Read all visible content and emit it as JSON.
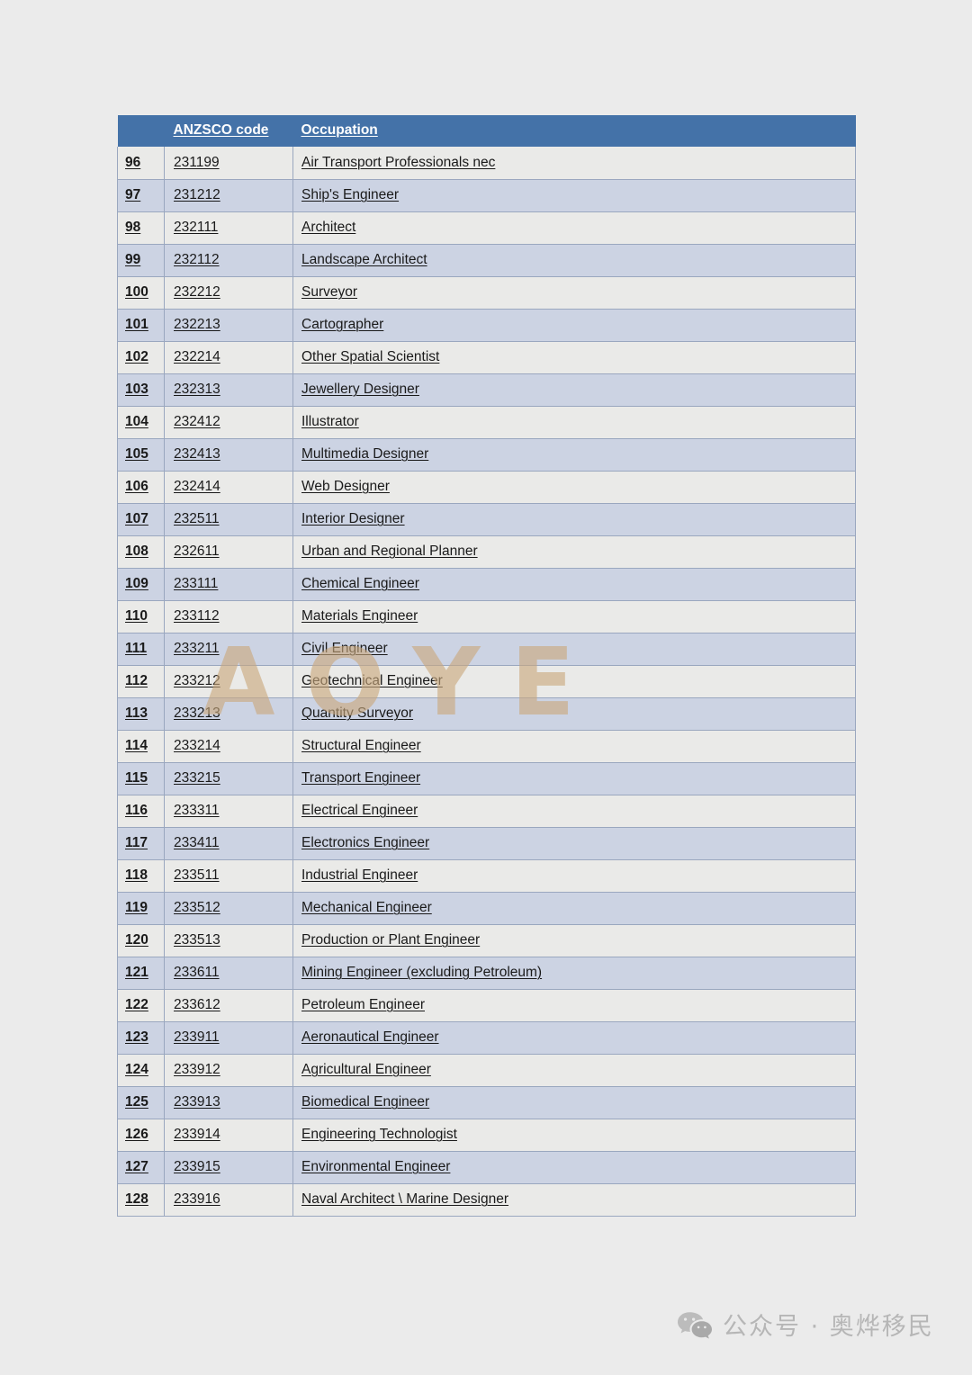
{
  "page": {
    "background_color": "#ebebeb"
  },
  "table": {
    "header_bg": "#4472a8",
    "row_color_a": "#eaeae8",
    "row_color_b": "#ccd3e3",
    "border_color": "#9aa7bf",
    "columns": [
      "",
      "ANZSCO code",
      "Occupation"
    ],
    "rows": [
      {
        "index": "96",
        "code": "231199",
        "occupation": "Air Transport Professionals nec"
      },
      {
        "index": "97",
        "code": "231212",
        "occupation": "Ship's Engineer"
      },
      {
        "index": "98",
        "code": "232111",
        "occupation": "Architect"
      },
      {
        "index": "99",
        "code": "232112",
        "occupation": "Landscape Architect"
      },
      {
        "index": "100",
        "code": "232212",
        "occupation": "Surveyor"
      },
      {
        "index": "101",
        "code": "232213",
        "occupation": "Cartographer"
      },
      {
        "index": "102",
        "code": "232214",
        "occupation": "Other Spatial Scientist"
      },
      {
        "index": "103",
        "code": "232313",
        "occupation": "Jewellery Designer"
      },
      {
        "index": "104",
        "code": "232412",
        "occupation": "Illustrator"
      },
      {
        "index": "105",
        "code": "232413",
        "occupation": "Multimedia Designer"
      },
      {
        "index": "106",
        "code": "232414",
        "occupation": "Web Designer"
      },
      {
        "index": "107",
        "code": "232511",
        "occupation": "Interior Designer"
      },
      {
        "index": "108",
        "code": "232611",
        "occupation": "Urban and Regional Planner"
      },
      {
        "index": "109",
        "code": "233111",
        "occupation": "Chemical Engineer"
      },
      {
        "index": "110",
        "code": "233112",
        "occupation": "Materials Engineer"
      },
      {
        "index": "111",
        "code": "233211",
        "occupation": "Civil Engineer"
      },
      {
        "index": "112",
        "code": "233212",
        "occupation": "Geotechnical Engineer"
      },
      {
        "index": "113",
        "code": "233213",
        "occupation": "Quantity Surveyor"
      },
      {
        "index": "114",
        "code": "233214",
        "occupation": "Structural Engineer"
      },
      {
        "index": "115",
        "code": "233215",
        "occupation": "Transport Engineer"
      },
      {
        "index": "116",
        "code": "233311",
        "occupation": "Electrical Engineer"
      },
      {
        "index": "117",
        "code": "233411",
        "occupation": "Electronics Engineer"
      },
      {
        "index": "118",
        "code": "233511",
        "occupation": "Industrial Engineer"
      },
      {
        "index": "119",
        "code": "233512",
        "occupation": "Mechanical Engineer"
      },
      {
        "index": "120",
        "code": "233513",
        "occupation": "Production or Plant Engineer"
      },
      {
        "index": "121",
        "code": "233611",
        "occupation": "Mining Engineer (excluding Petroleum)"
      },
      {
        "index": "122",
        "code": "233612",
        "occupation": "Petroleum Engineer"
      },
      {
        "index": "123",
        "code": "233911",
        "occupation": "Aeronautical Engineer"
      },
      {
        "index": "124",
        "code": "233912",
        "occupation": "Agricultural Engineer"
      },
      {
        "index": "125",
        "code": "233913",
        "occupation": "Biomedical Engineer"
      },
      {
        "index": "126",
        "code": "233914",
        "occupation": "Engineering Technologist"
      },
      {
        "index": "127",
        "code": "233915",
        "occupation": "Environmental Engineer"
      },
      {
        "index": "128",
        "code": "233916",
        "occupation": "Naval Architect \\ Marine Designer"
      }
    ]
  },
  "watermark": {
    "text": "AOYE",
    "color": "#c9a87c"
  },
  "footer": {
    "icon": "wechat-icon",
    "text": "公众号 · 奥烨移民",
    "color": "#b6b6b6"
  }
}
